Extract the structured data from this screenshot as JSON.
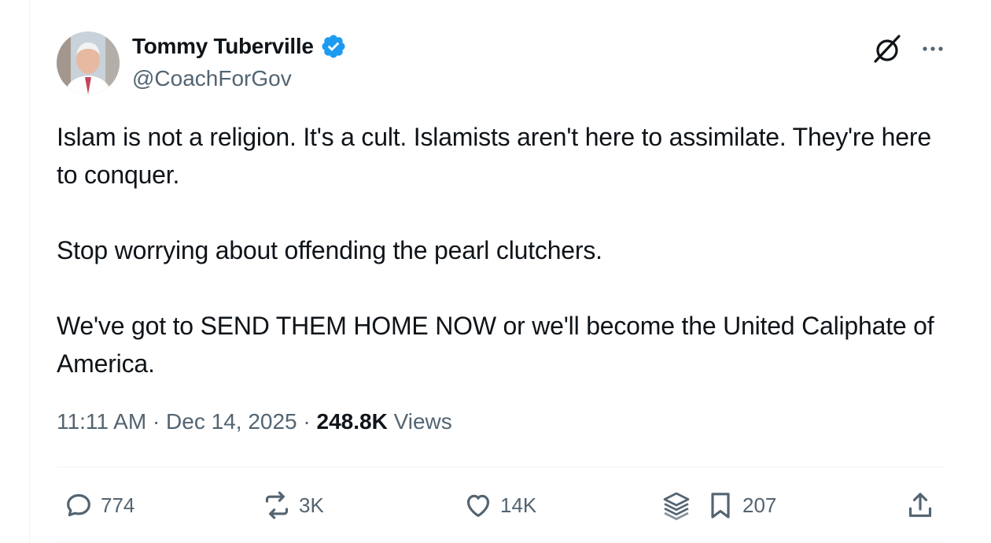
{
  "author": {
    "display_name": "Tommy Tuberville",
    "handle": "@CoachForGov",
    "verified": true
  },
  "tweet": {
    "paragraphs": [
      "Islam is not a religion. It's a cult. Islamists aren't here to assimilate. They're here to conquer.",
      "Stop worrying about offending the pearl clutchers.",
      "We've got to SEND THEM HOME NOW or we'll become the United Caliphate of America."
    ],
    "time": "11:11 AM",
    "date": "Dec 14, 2025",
    "separator": "·",
    "views_count": "248.8K",
    "views_label": "Views"
  },
  "actions": {
    "replies": "774",
    "reposts": "3K",
    "likes": "14K",
    "bookmarks": "207"
  },
  "colors": {
    "verified": "#1d9bf0",
    "secondary_text": "#536471",
    "primary_text": "#0f1419",
    "divider": "#eff3f4"
  },
  "icons": [
    "verified-badge-icon",
    "grok-icon",
    "more-icon",
    "reply-icon",
    "repost-icon",
    "like-icon",
    "analytics-icon",
    "bookmark-icon",
    "share-icon"
  ]
}
